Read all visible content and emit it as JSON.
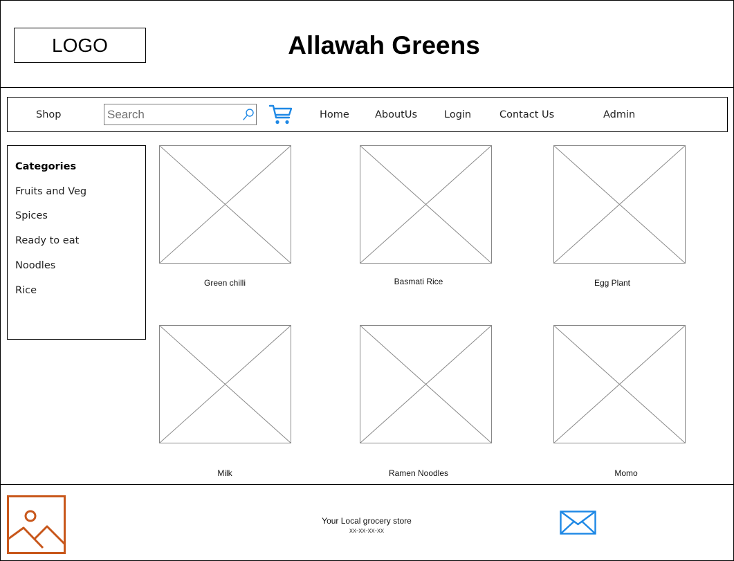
{
  "header": {
    "logo_text": "LOGO",
    "site_title": "Allawah Greens"
  },
  "nav": {
    "shop": "Shop",
    "search_placeholder": "Search",
    "home": "Home",
    "about": "AboutUs",
    "login": "Login",
    "contact": "Contact Us",
    "admin": "Admin",
    "accent_color": "#1e88e5"
  },
  "sidebar": {
    "heading": "Categories",
    "categories": [
      "Fruits and Veg",
      "Spices",
      "Ready to eat",
      "Noodles",
      "Rice"
    ]
  },
  "products": [
    {
      "name": "Green chilli"
    },
    {
      "name": "Basmati Rice"
    },
    {
      "name": "Egg Plant"
    },
    {
      "name": "Milk"
    },
    {
      "name": "Ramen Noodles"
    },
    {
      "name": "Momo"
    }
  ],
  "footer": {
    "tagline": "Your Local grocery store",
    "phone": "xx-xx-xx-xx",
    "image_icon_color": "#c8571b",
    "mail_icon_color": "#1e88e5"
  },
  "icons": {
    "search": "search-icon",
    "cart": "cart-icon",
    "placeholder": "image-placeholder-icon",
    "footer_image": "image-icon",
    "mail": "mail-icon"
  }
}
